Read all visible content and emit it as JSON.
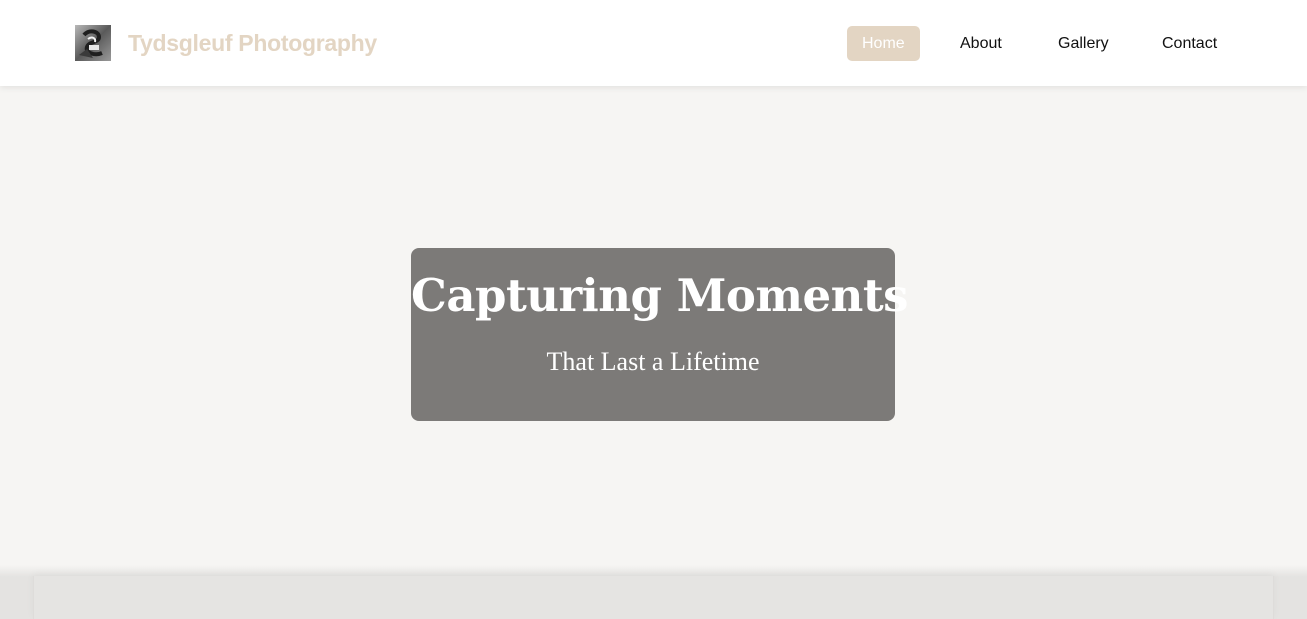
{
  "header": {
    "brand_name": "Tydsgleuf Photography",
    "logo_icon": "camera-photo-icon"
  },
  "nav": {
    "items": [
      {
        "label": "Home",
        "active": true
      },
      {
        "label": "About",
        "active": false
      },
      {
        "label": "Gallery",
        "active": false
      },
      {
        "label": "Contact",
        "active": false
      }
    ]
  },
  "hero": {
    "title": "Capturing Moments",
    "subtitle": "That Last a Lifetime"
  },
  "colors": {
    "accent": "#e3d5c3",
    "hero_box": "#7c7a78",
    "page_bg": "#f6f5f3",
    "nav_text": "#111111"
  }
}
